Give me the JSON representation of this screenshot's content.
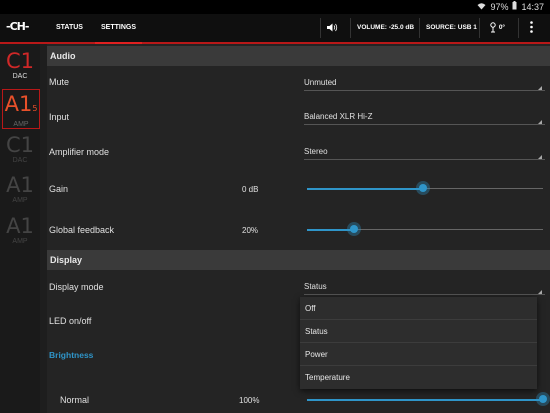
{
  "status_bar": {
    "battery": "97%",
    "time": "14:37"
  },
  "app": {
    "logo": "-CH-"
  },
  "tabs": [
    {
      "label": "STATUS"
    },
    {
      "label": "SETTINGS"
    }
  ],
  "toolbar": {
    "volume": "VOLUME: -25.0 dB",
    "source": "SOURCE: USB 1",
    "rotation": "0°"
  },
  "sidebar": [
    {
      "code": "C1",
      "type": "DAC",
      "color": "#d02828"
    },
    {
      "code": "A1",
      "badge": "5",
      "type": "AMP",
      "color": "#e8502a"
    },
    {
      "code": "C1",
      "type": "DAC",
      "color": "#444444"
    },
    {
      "code": "A1",
      "type": "AMP",
      "color": "#444444"
    },
    {
      "code": "A1",
      "type": "AMP",
      "color": "#444444"
    }
  ],
  "audio": {
    "header": "Audio",
    "mute": {
      "label": "Mute",
      "value": "Unmuted"
    },
    "input": {
      "label": "Input",
      "value": "Balanced XLR Hi-Z"
    },
    "amp_mode": {
      "label": "Amplifier mode",
      "value": "Stereo"
    },
    "gain": {
      "label": "Gain",
      "value": "0 dB",
      "level": 0.49
    },
    "feedback": {
      "label": "Global feedback",
      "value": "20%",
      "level": 0.2
    }
  },
  "display": {
    "header": "Display",
    "mode": {
      "label": "Display mode",
      "value": "Status"
    },
    "led": {
      "label": "LED on/off"
    },
    "brightness": {
      "label": "Brightness"
    },
    "normal": {
      "label": "Normal",
      "value": "100%",
      "level": 1.0
    }
  },
  "dropdown_options": [
    "Off",
    "Status",
    "Power",
    "Temperature"
  ],
  "colors": {
    "accent": "#2f95c9",
    "brand_red": "#b81818"
  }
}
